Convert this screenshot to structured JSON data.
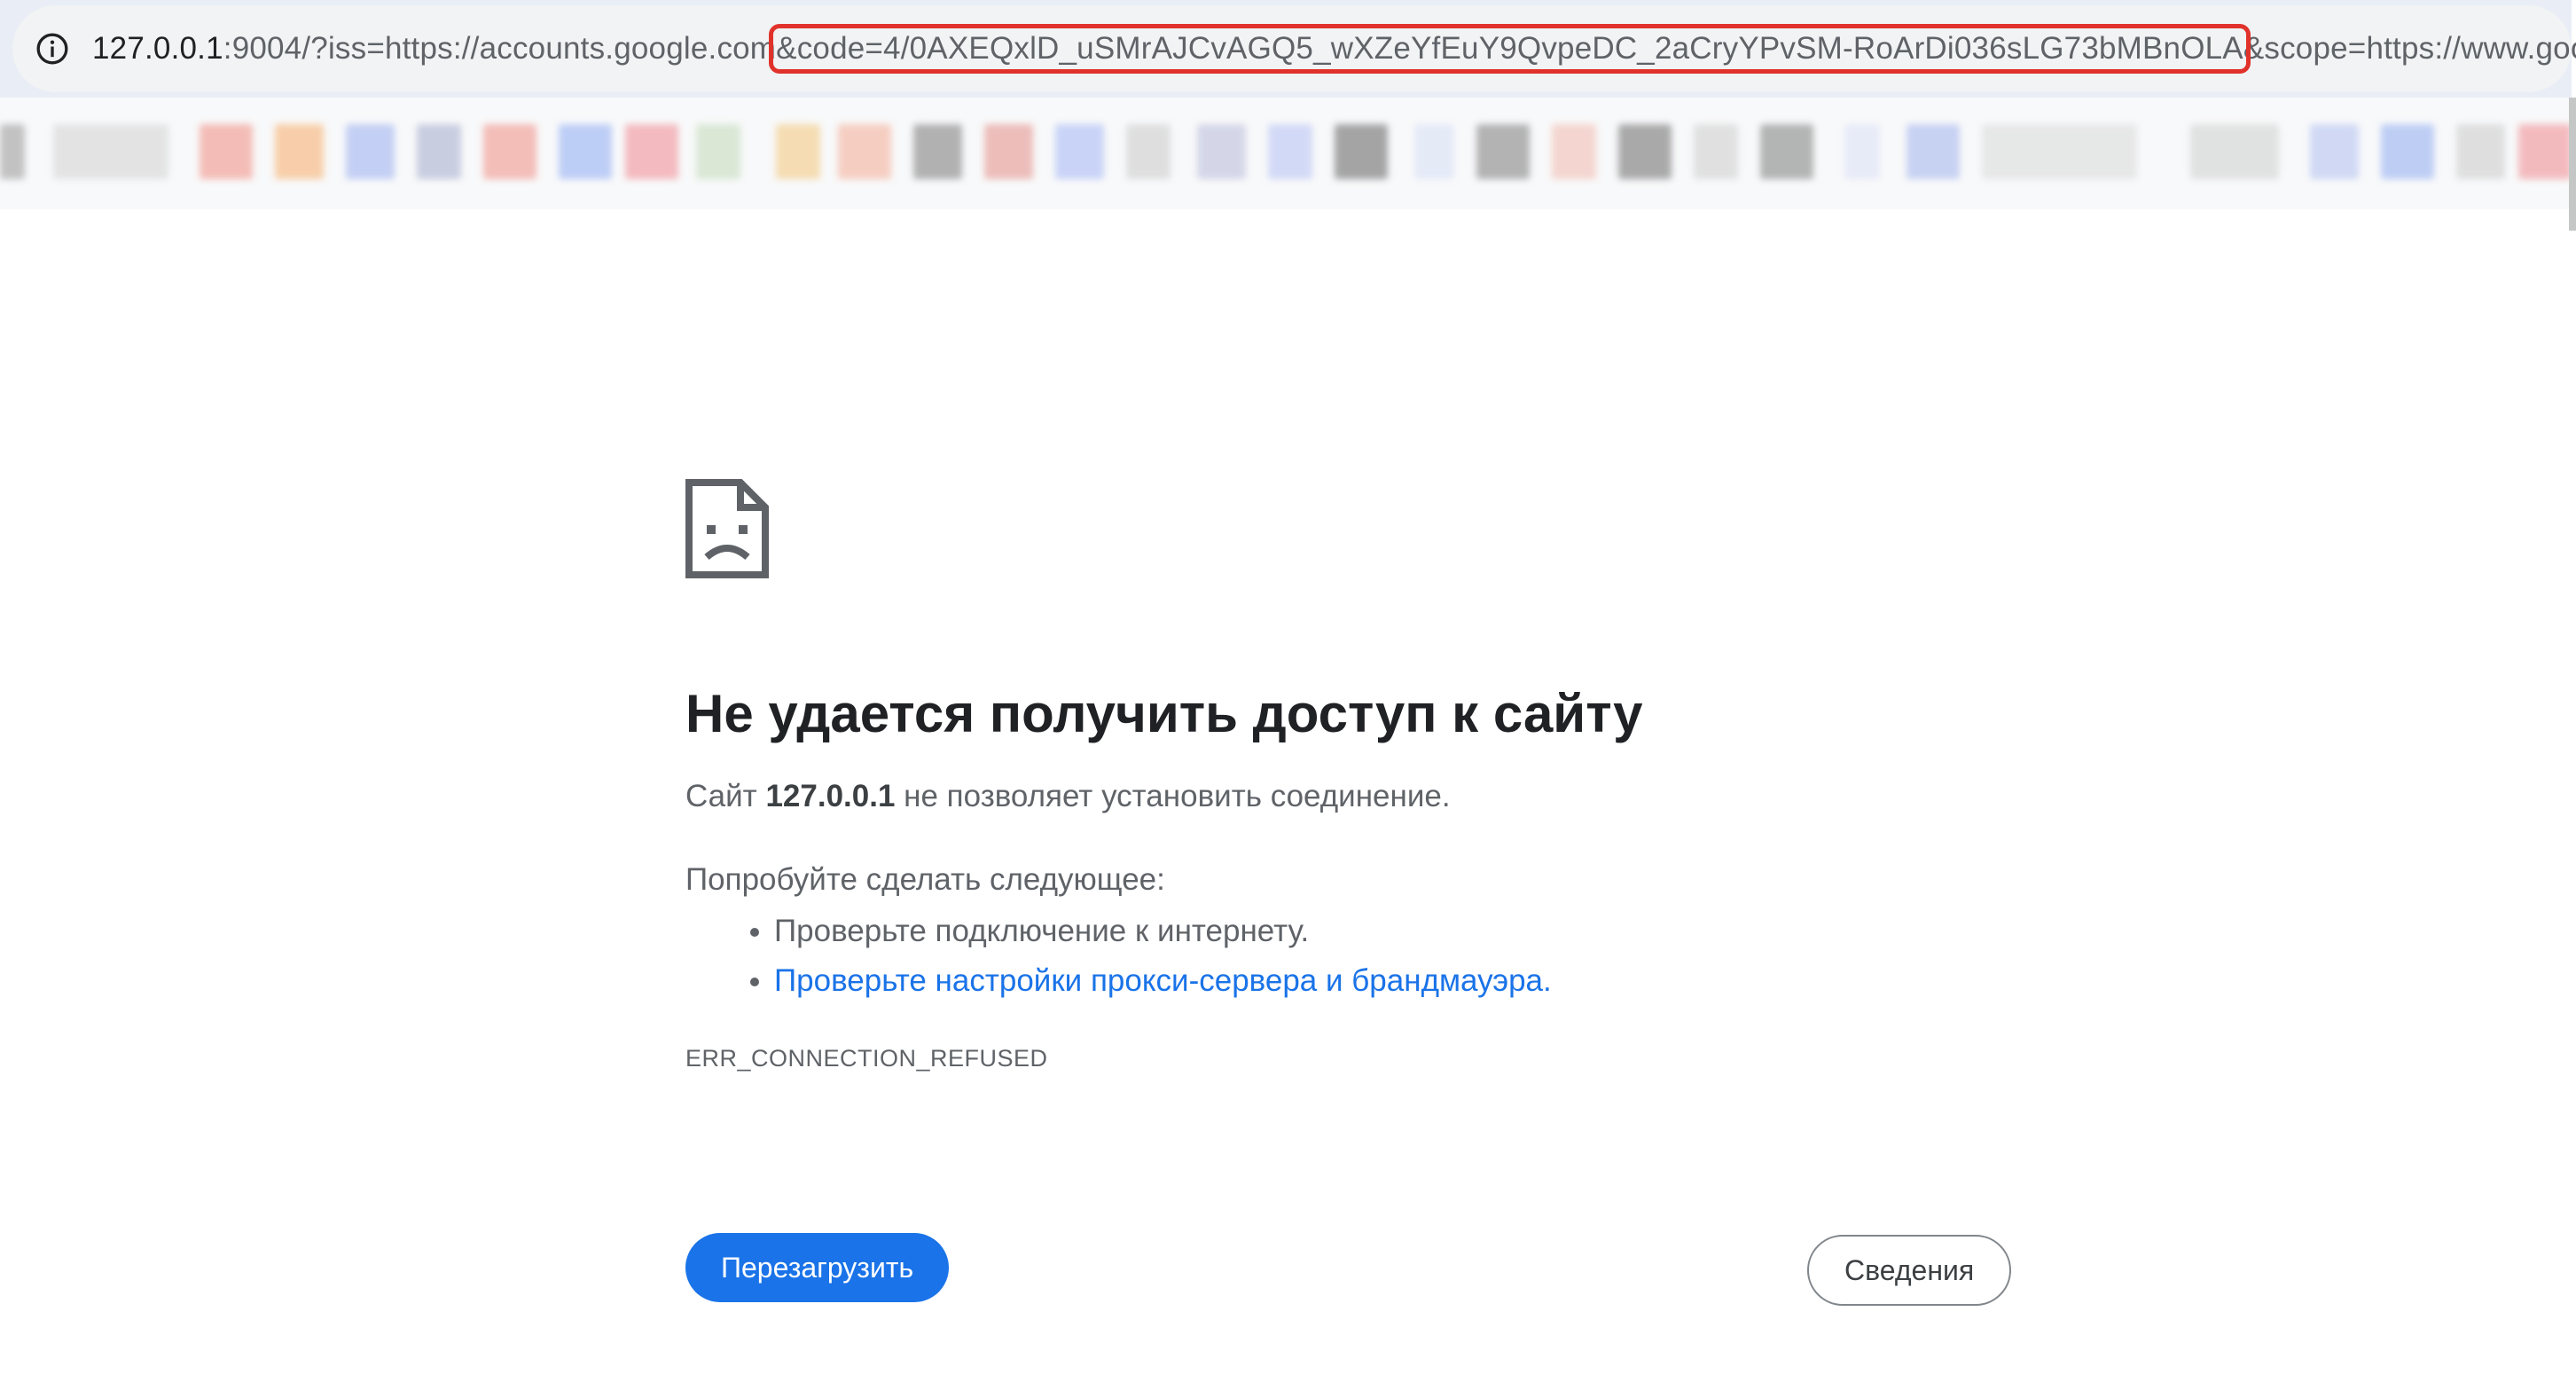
{
  "browser": {
    "url_host": "127.0.0.1",
    "url_port_path": ":9004/?iss=https://accounts.google.com",
    "url_highlighted": "&code=4/0AXEQxlD_uSMrAJCvAGQ5_wXZeYfEuY9QvpeDC_2aCryYPvSM-RoArDi036sLG73bMBnOLA",
    "url_rest": "&scope=https://www.googlea...",
    "highlight_color": "#e0322b",
    "site_info_icon": "info-icon"
  },
  "error_page": {
    "icon": "sad-document-icon",
    "title": "Не удается получить доступ к сайту",
    "lead_prefix": "Сайт ",
    "lead_host": "127.0.0.1",
    "lead_suffix": " не позволяет установить соединение.",
    "suggest_heading": "Попробуйте сделать следующее:",
    "suggestions": [
      "Проверьте подключение к интернету.",
      "Проверьте настройки прокси-сервера и брандмауэра."
    ],
    "error_code": "ERR_CONNECTION_REFUSED",
    "reload_label": "Перезагрузить",
    "details_label": "Сведения",
    "accent_color": "#1a73e8"
  }
}
